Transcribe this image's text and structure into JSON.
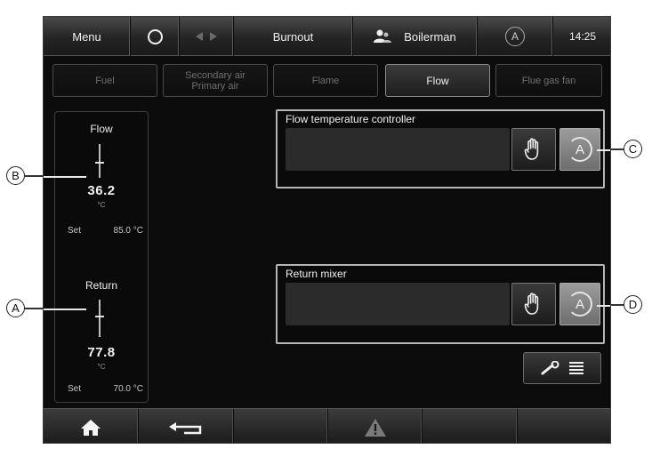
{
  "topbar": {
    "menu_label": "Menu",
    "title": "Burnout",
    "user_label": "Boilerman",
    "auto_symbol": "A",
    "time": "14:25",
    "icons": [
      "circle-icon",
      "arrow-left-icon",
      "arrow-right-icon",
      "user-group-icon",
      "auto-mode-icon"
    ]
  },
  "tabs": [
    {
      "label": "Fuel",
      "active": false
    },
    {
      "label_line1": "Secondary air",
      "label_line2": "Primary air",
      "active": false
    },
    {
      "label": "Flame",
      "active": false
    },
    {
      "label": "Flow",
      "active": true
    },
    {
      "label": "Flue gas fan",
      "active": false
    }
  ],
  "gauges": {
    "flow": {
      "title": "Flow",
      "value": "36.2",
      "unit": "°C",
      "set_label": "Set",
      "set_value": "85.0 °C"
    },
    "return": {
      "title": "Return",
      "value": "77.8",
      "unit": "°C",
      "set_label": "Set",
      "set_value": "70.0 °C"
    }
  },
  "controllers": {
    "flow_temp": {
      "title": "Flow temperature controller",
      "auto_symbol": "A"
    },
    "return_mixer": {
      "title": "Return mixer",
      "auto_symbol": "A"
    }
  },
  "callouts": {
    "a": "A",
    "b": "B",
    "c": "C",
    "d": "D"
  },
  "bottombar": {
    "icons": [
      "home-icon",
      "back-arrow-icon",
      "warning-icon"
    ]
  },
  "colors": {
    "background": "#0c0c0c",
    "bar": "#2a2a2a",
    "text": "#f0f0f0",
    "inactive_text": "#6f6f6f",
    "frame": "#b5b5b5"
  }
}
